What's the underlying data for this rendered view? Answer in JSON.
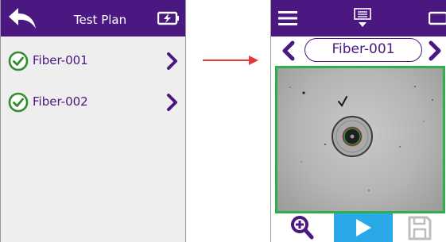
{
  "left": {
    "header": {
      "title": "Test Plan",
      "back_icon": "back-arrow-icon",
      "battery_icon": "battery-charging-icon"
    },
    "items": [
      {
        "label": "Fiber-001",
        "status_icon": "check-circle-icon",
        "status_color": "#2f8f2f"
      },
      {
        "label": "Fiber-002",
        "status_icon": "check-circle-icon",
        "status_color": "#2f8f2f"
      }
    ]
  },
  "right": {
    "header": {
      "menu_icon": "hamburger-menu-icon",
      "list_icon": "test-plan-list-icon",
      "battery_icon": "battery-icon"
    },
    "fiber_selector": {
      "value": "Fiber-001"
    },
    "bottom_bar": {
      "zoom_icon": "zoom-in-icon",
      "play_icon": "play-icon",
      "save_icon": "save-icon"
    }
  },
  "colors": {
    "brand": "#4b1780",
    "accent_play": "#29a9e8",
    "pass_border": "#2fae4a",
    "arrow": "#e53935"
  }
}
